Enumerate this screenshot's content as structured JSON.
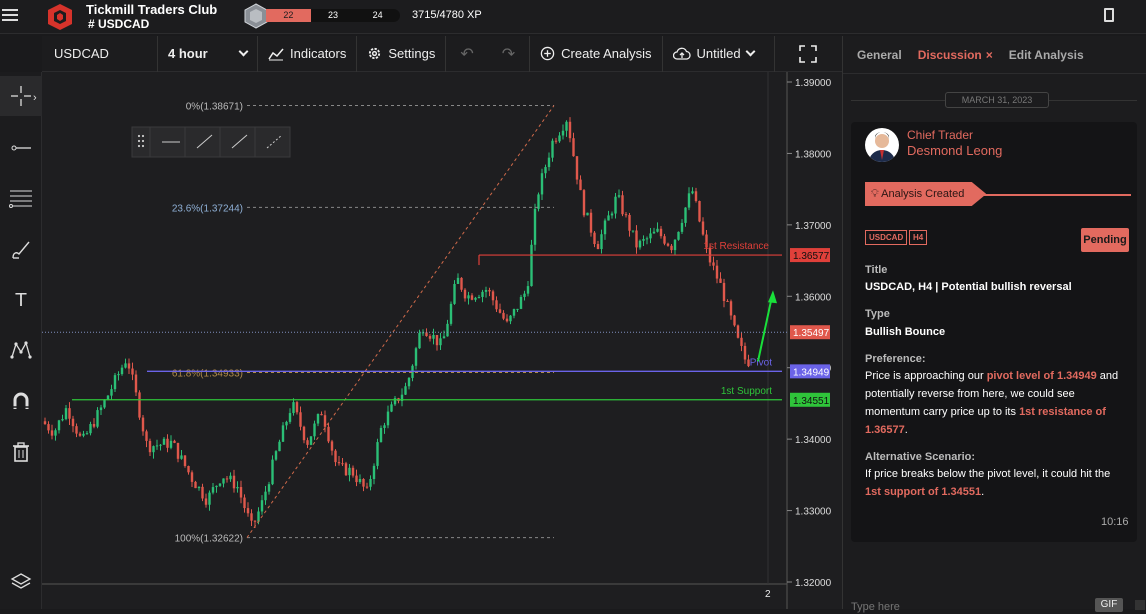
{
  "app": {
    "title": "Tickmill Traders Club",
    "channel": "# USDCAD",
    "level_badge_icon": "level-hex-icon",
    "xp_levels": [
      "22",
      "23",
      "24"
    ],
    "xp_text": "3715/4780 XP",
    "xp_fraction": 0.777
  },
  "toolbar": {
    "symbol": "USDCAD",
    "interval": "4 hour",
    "indicators": "Indicators",
    "settings": "Settings",
    "create_analysis": "Create Analysis",
    "untitled": "Untitled"
  },
  "chart": {
    "price_ticks": [
      "1.39000",
      "1.38000",
      "1.37000",
      "1.36000",
      "1.35000",
      "1.34000",
      "1.33000",
      "1.32000"
    ],
    "x_tick": "2",
    "fib": [
      {
        "label": "0%(1.38671)",
        "price": 1.38671
      },
      {
        "label": "23.6%(1.37244)",
        "price": 1.37244
      },
      {
        "label": "61.8%(1.34933)",
        "price": 1.34933
      },
      {
        "label": "100%(1.32622)",
        "price": 1.32622
      }
    ],
    "levels": [
      {
        "label": "1st Resistance",
        "price_label": "1.36577",
        "price": 1.36577,
        "color": "#e0403a"
      },
      {
        "label": "Pivot",
        "price_label": "1.34949",
        "price": 1.34949,
        "color": "#6b63e8"
      },
      {
        "label": "1st Support",
        "price_label": "1.34551",
        "price": 1.34551,
        "color": "#2fc43a"
      }
    ],
    "current_price": "1.35497",
    "current_price_value": 1.35497,
    "colors": {
      "up": "#2bbf76",
      "down": "#e0584c",
      "fib": "#aaaaaa",
      "arrow": "#19e03a"
    }
  },
  "panel": {
    "tabs": [
      "General",
      "Discussion",
      "Edit Analysis"
    ],
    "date": "MARCH 31, 2023",
    "author_role": "Chief Trader",
    "author_name": "Desmond Leong",
    "analysis_created": "Analysis Created",
    "tag_symbol": "USDCAD",
    "tag_tf": "H4",
    "status": "Pending",
    "title_label": "Title",
    "title_value": "USDCAD, H4 | Potential bullish reversal",
    "type_label": "Type",
    "type_value": "Bullish Bounce",
    "preference_label": "Preference:",
    "pref_1": "Price is approaching our ",
    "pref_hl1": "pivot level of 1.34949",
    "pref_2": " and potentially reverse from here, we could see momentum carry price up to its ",
    "pref_hl2": "1st resistance of 1.36577",
    "pref_3": ".",
    "alt_label": "Alternative Scenario:",
    "alt_1": "If price breaks below the pivot level, it could hit the ",
    "alt_hl": "1st support of 1.34551",
    "alt_2": ".",
    "time": "10:16",
    "input_placeholder": "Type here",
    "gif": "GIF"
  }
}
